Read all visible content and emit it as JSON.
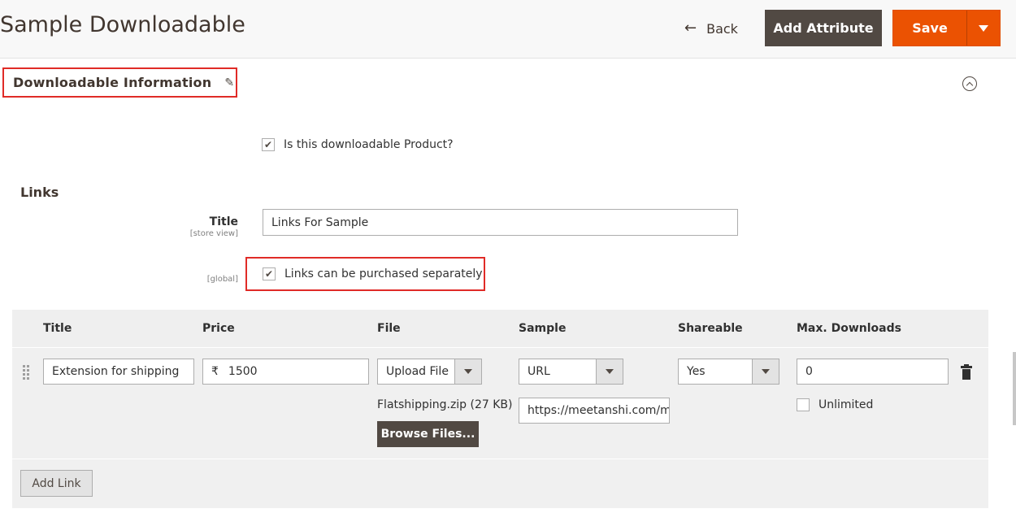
{
  "header": {
    "title": "Sample Downloadable",
    "back_label": "Back",
    "add_attribute_label": "Add Attribute",
    "save_label": "Save"
  },
  "section": {
    "title": "Downloadable Information"
  },
  "form": {
    "is_downloadable_label": "Is this downloadable Product?",
    "is_downloadable_checked": true,
    "links_heading": "Links",
    "title_label": "Title",
    "title_scope": "[store view]",
    "title_value": "Links For Sample",
    "global_scope": "[global]",
    "purchase_separately_label": "Links can be purchased separately",
    "purchase_separately_checked": true
  },
  "links_table": {
    "columns": [
      "Title",
      "Price",
      "File",
      "Sample",
      "Shareable",
      "Max. Downloads"
    ],
    "rows": [
      {
        "title": "Extension for shipping",
        "currency_symbol": "₹",
        "price": "1500",
        "file_type": "Upload File",
        "file_name": "Flatshipping.zip (27 KB)",
        "browse_label": "Browse Files...",
        "sample_type": "URL",
        "sample_url": "https://meetanshi.com/m",
        "shareable": "Yes",
        "max_downloads": "0",
        "unlimited_label": "Unlimited",
        "unlimited_checked": false
      }
    ],
    "add_link_label": "Add Link"
  },
  "colors": {
    "accent_orange": "#eb5202",
    "dark_button": "#514943",
    "highlight_red": "#e02b27"
  },
  "icons": [
    "arrow-left-icon",
    "pencil-icon",
    "collapse-chevron-icon",
    "checkmark-icon",
    "drag-handle-icon",
    "rupee-icon",
    "chevron-down-icon",
    "trash-icon"
  ]
}
